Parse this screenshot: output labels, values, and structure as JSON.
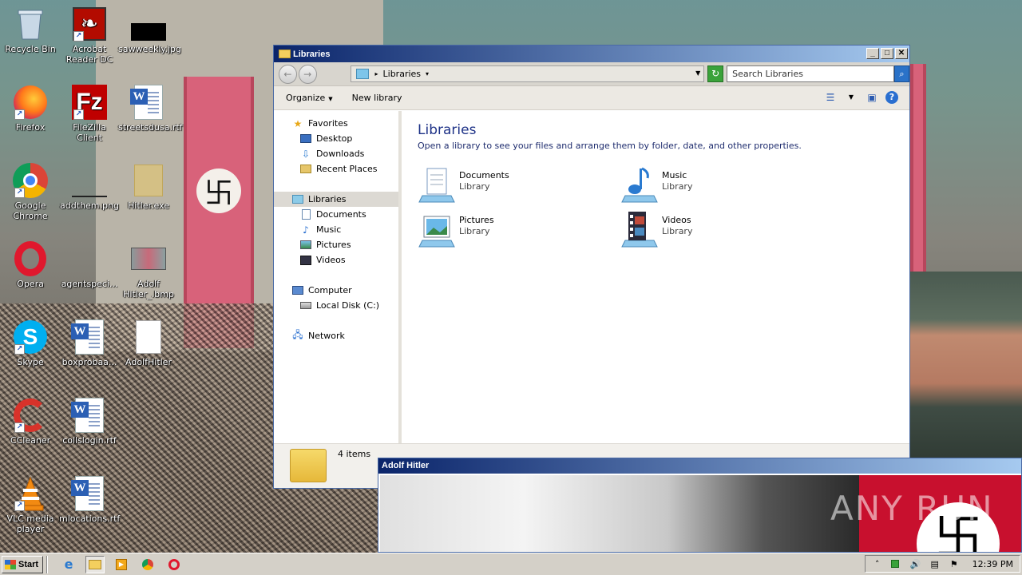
{
  "desktop": {
    "icons": [
      {
        "label": "Recycle Bin",
        "icon": "recycle-bin-icon"
      },
      {
        "label": "Acrobat Reader DC",
        "icon": "acrobat-icon"
      },
      {
        "label": "sawweekly.jpg",
        "icon": "image-file-icon"
      },
      {
        "label": "Firefox",
        "icon": "firefox-icon"
      },
      {
        "label": "FileZilla Client",
        "icon": "filezilla-icon"
      },
      {
        "label": "streetsdusa.rtf",
        "icon": "word-doc-icon"
      },
      {
        "label": "Google Chrome",
        "icon": "chrome-icon"
      },
      {
        "label": "addthem.png",
        "icon": "image-file-icon"
      },
      {
        "label": "Hitler.exe",
        "icon": "exe-icon"
      },
      {
        "label": "Opera",
        "icon": "opera-icon"
      },
      {
        "label": "agentspeci...",
        "icon": "image-file-icon"
      },
      {
        "label": "Adolf Hitler_.bmp",
        "icon": "bitmap-icon"
      },
      {
        "label": "Skype",
        "icon": "skype-icon"
      },
      {
        "label": "boxprobaa...",
        "icon": "word-doc-icon"
      },
      {
        "label": "AdolfHitler",
        "icon": "blank-file-icon"
      },
      {
        "label": "CCleaner",
        "icon": "ccleaner-icon"
      },
      {
        "label": "collslogin.rtf",
        "icon": "word-doc-icon"
      },
      {
        "label": "VLC media player",
        "icon": "vlc-icon"
      },
      {
        "label": "mlocations.rtf",
        "icon": "word-doc-icon"
      }
    ]
  },
  "explorer": {
    "title": "Libraries",
    "address": "Libraries",
    "search_placeholder": "Search Libraries",
    "toolbar": {
      "organize": "Organize",
      "new_library": "New library"
    },
    "nav": {
      "favorites": "Favorites",
      "desktop": "Desktop",
      "downloads": "Downloads",
      "recent": "Recent Places",
      "libraries": "Libraries",
      "documents": "Documents",
      "music": "Music",
      "pictures": "Pictures",
      "videos": "Videos",
      "computer": "Computer",
      "local_disk": "Local Disk (C:)",
      "network": "Network"
    },
    "content": {
      "heading": "Libraries",
      "description": "Open a library to see your files and arrange them by folder, date, and other properties.",
      "libraries": [
        {
          "name": "Documents",
          "type": "Library"
        },
        {
          "name": "Music",
          "type": "Library"
        },
        {
          "name": "Pictures",
          "type": "Library"
        },
        {
          "name": "Videos",
          "type": "Library"
        }
      ]
    },
    "status": {
      "items": "4 items"
    }
  },
  "viewer": {
    "title": "Adolf Hitler"
  },
  "watermark": "ANY RUN",
  "taskbar": {
    "start": "Start",
    "clock": "12:39 PM"
  },
  "colors": {
    "titlebar_start": "#0a246a",
    "titlebar_end": "#a6caf0",
    "content_heading": "#1e3287"
  }
}
